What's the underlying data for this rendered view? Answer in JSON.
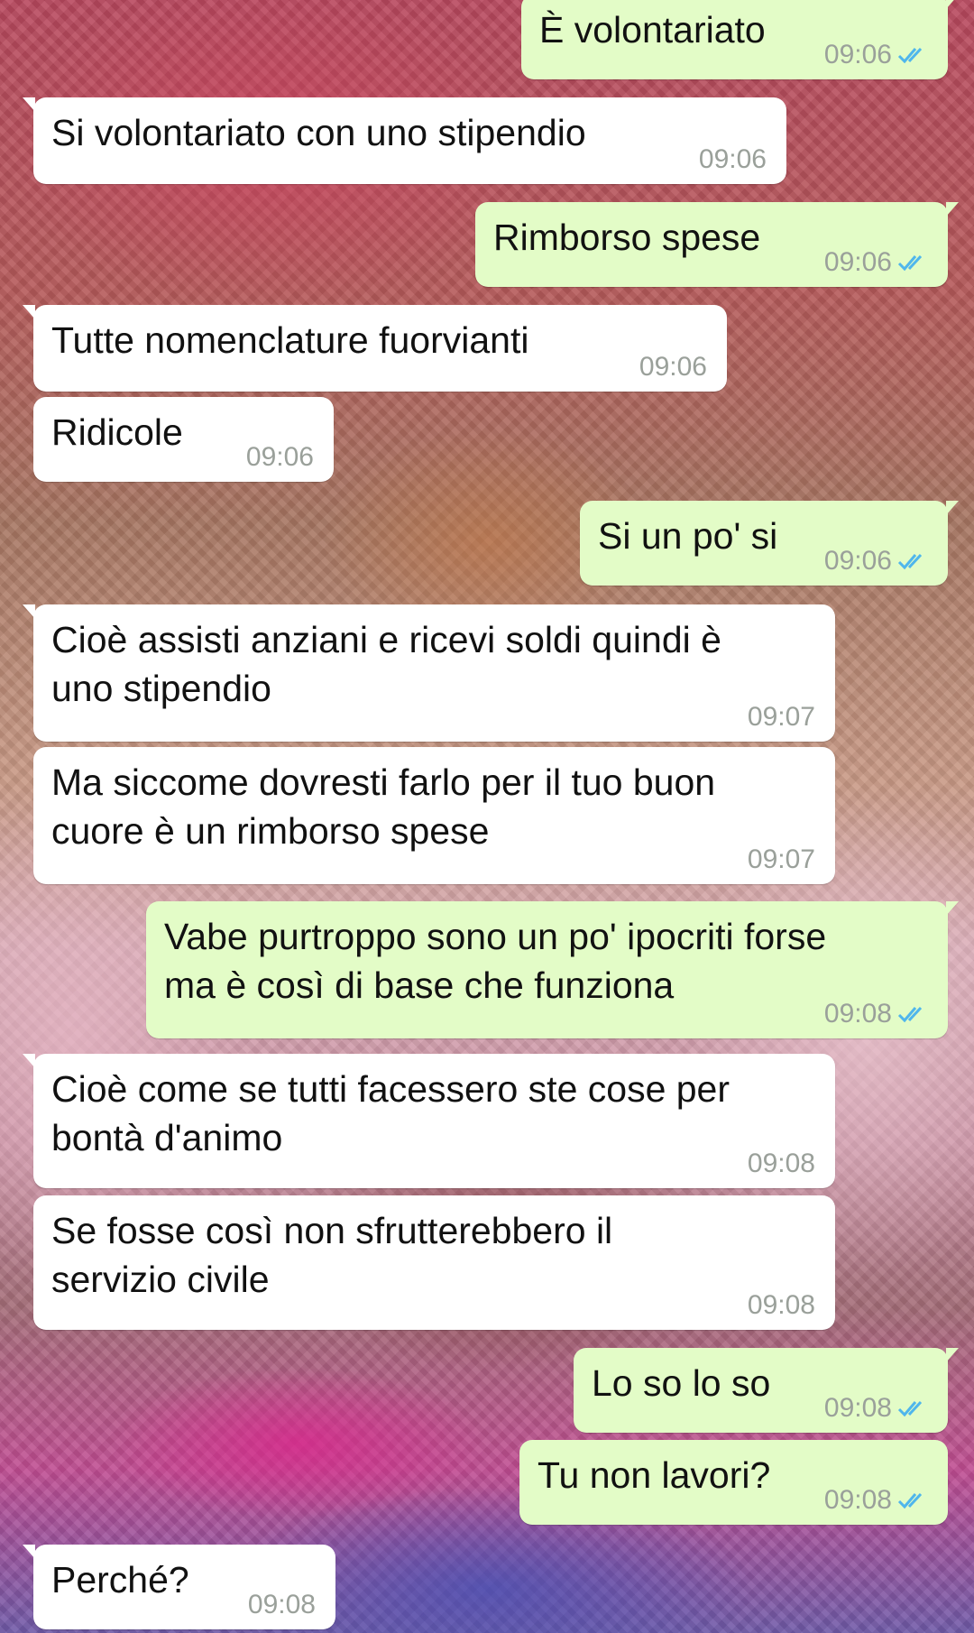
{
  "chat": {
    "messages": [
      {
        "dir": "out",
        "text": "È volontariato",
        "time": "09:06",
        "status": "read"
      },
      {
        "dir": "in",
        "text": "Si volontariato con uno stipendio",
        "time": "09:06"
      },
      {
        "dir": "out",
        "text": "Rimborso spese",
        "time": "09:06",
        "status": "read"
      },
      {
        "dir": "in",
        "text": "Tutte nomenclature fuorvianti",
        "time": "09:06"
      },
      {
        "dir": "in",
        "text": "Ridicole",
        "time": "09:06"
      },
      {
        "dir": "out",
        "text": "Si un po' si",
        "time": "09:06",
        "status": "read"
      },
      {
        "dir": "in",
        "text": "Cioè assisti anziani e ricevi soldi quindi è\nuno stipendio",
        "time": "09:07"
      },
      {
        "dir": "in",
        "text": "Ma siccome dovresti farlo per il tuo buon\ncuore è un rimborso spese",
        "time": "09:07"
      },
      {
        "dir": "out",
        "text": "Vabe purtroppo sono un po' ipocriti forse\nma è così di base che funziona",
        "time": "09:08",
        "status": "read"
      },
      {
        "dir": "in",
        "text": "Cioè come se tutti facessero ste cose per\nbontà d'animo",
        "time": "09:08"
      },
      {
        "dir": "in",
        "text": "Se fosse così non sfrutterebbero il\nservizio civile",
        "time": "09:08"
      },
      {
        "dir": "out",
        "text": "Lo so lo so",
        "time": "09:08",
        "status": "read"
      },
      {
        "dir": "out",
        "text": "Tu non lavori?",
        "time": "09:08",
        "status": "read"
      },
      {
        "dir": "in",
        "text": "Perché?",
        "time": "09:08"
      }
    ]
  },
  "colors": {
    "incoming_bubble": "#ffffff",
    "outgoing_bubble": "#e3fcc7",
    "read_tick": "#4fb6ec",
    "timestamp": "#9aa09a",
    "message_text": "#111111"
  },
  "icons": {
    "read_receipt": "double-check-icon"
  }
}
